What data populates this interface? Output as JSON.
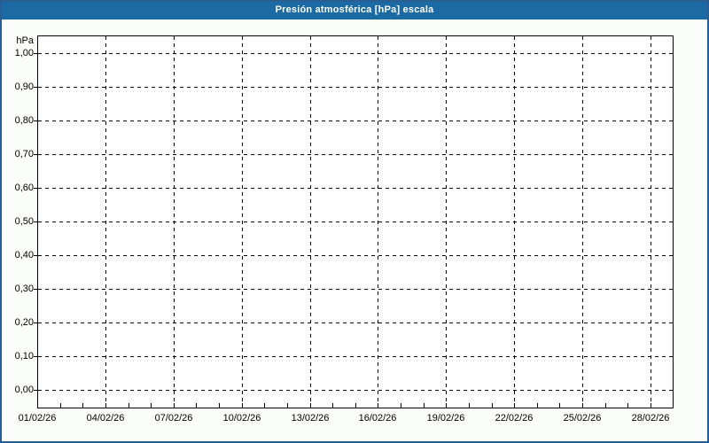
{
  "title": "Presión atmosférica [hPa] escala",
  "chart_data": {
    "type": "line",
    "title": "Presión atmosférica [hPa] escala",
    "ylabel": "hPa",
    "xlabel": "",
    "ylim": [
      0.0,
      1.0
    ],
    "y_tick_step": 0.1,
    "y_ticks": [
      {
        "label": "1,00",
        "value": 1.0
      },
      {
        "label": "0,90",
        "value": 0.9
      },
      {
        "label": "0,80",
        "value": 0.8
      },
      {
        "label": "0,70",
        "value": 0.7
      },
      {
        "label": "0,60",
        "value": 0.6
      },
      {
        "label": "0,50",
        "value": 0.5
      },
      {
        "label": "0,40",
        "value": 0.4
      },
      {
        "label": "0,30",
        "value": 0.3
      },
      {
        "label": "0,20",
        "value": 0.2
      },
      {
        "label": "0,10",
        "value": 0.1
      },
      {
        "label": "0,00",
        "value": 0.0
      }
    ],
    "x_ticks": [
      {
        "label": "01/02/26",
        "day": 0
      },
      {
        "label": "04/02/26",
        "day": 3
      },
      {
        "label": "07/02/26",
        "day": 6
      },
      {
        "label": "10/02/26",
        "day": 9
      },
      {
        "label": "13/02/26",
        "day": 12
      },
      {
        "label": "16/02/26",
        "day": 15
      },
      {
        "label": "19/02/26",
        "day": 18
      },
      {
        "label": "22/02/26",
        "day": 21
      },
      {
        "label": "25/02/26",
        "day": 24
      },
      {
        "label": "28/02/26",
        "day": 27
      }
    ],
    "x_minor_tick_every_days": 1,
    "x_total_days": 28,
    "grid": "dashed",
    "legend": "none",
    "series": []
  },
  "colors": {
    "titlebar_background": "#1B6AA4",
    "titlebar_text": "#FFFFFF",
    "window_border": "#2A5E90",
    "window_background": "#FBFDFA",
    "plot_background": "#FFFFFF",
    "axis_and_grid": "#000000"
  }
}
